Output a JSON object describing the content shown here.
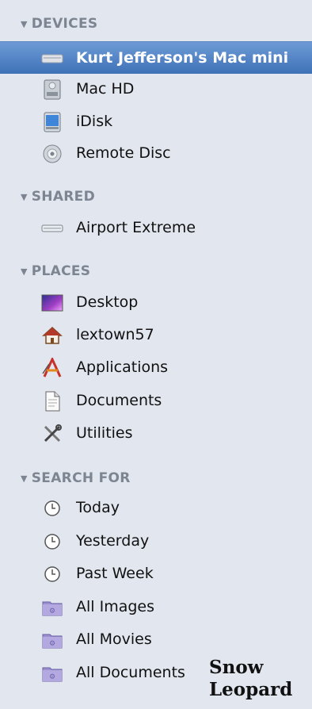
{
  "sections": {
    "devices": {
      "header": "DEVICES",
      "items": [
        {
          "label": "Kurt Jefferson's Mac mini",
          "icon": "mac-mini-icon"
        },
        {
          "label": "Mac HD",
          "icon": "hard-drive-icon"
        },
        {
          "label": "iDisk",
          "icon": "idisk-icon"
        },
        {
          "label": "Remote Disc",
          "icon": "disc-icon"
        }
      ]
    },
    "shared": {
      "header": "SHARED",
      "items": [
        {
          "label": "Airport Extreme",
          "icon": "airport-icon"
        }
      ]
    },
    "places": {
      "header": "PLACES",
      "items": [
        {
          "label": "Desktop",
          "icon": "desktop-icon"
        },
        {
          "label": "lextown57",
          "icon": "home-icon"
        },
        {
          "label": "Applications",
          "icon": "applications-icon"
        },
        {
          "label": "Documents",
          "icon": "documents-icon"
        },
        {
          "label": "Utilities",
          "icon": "utilities-icon"
        }
      ]
    },
    "search_for": {
      "header": "SEARCH FOR",
      "items": [
        {
          "label": "Today",
          "icon": "clock-icon"
        },
        {
          "label": "Yesterday",
          "icon": "clock-icon"
        },
        {
          "label": "Past Week",
          "icon": "clock-icon"
        },
        {
          "label": "All Images",
          "icon": "smart-folder-icon"
        },
        {
          "label": "All Movies",
          "icon": "smart-folder-icon"
        },
        {
          "label": "All Documents",
          "icon": "smart-folder-icon"
        }
      ]
    }
  },
  "watermark": {
    "line1": "Snow",
    "line2": "Leopard"
  },
  "colors": {
    "background": "#e2e7ef",
    "selection": "#3e71b7",
    "header_text": "#7d8592"
  }
}
